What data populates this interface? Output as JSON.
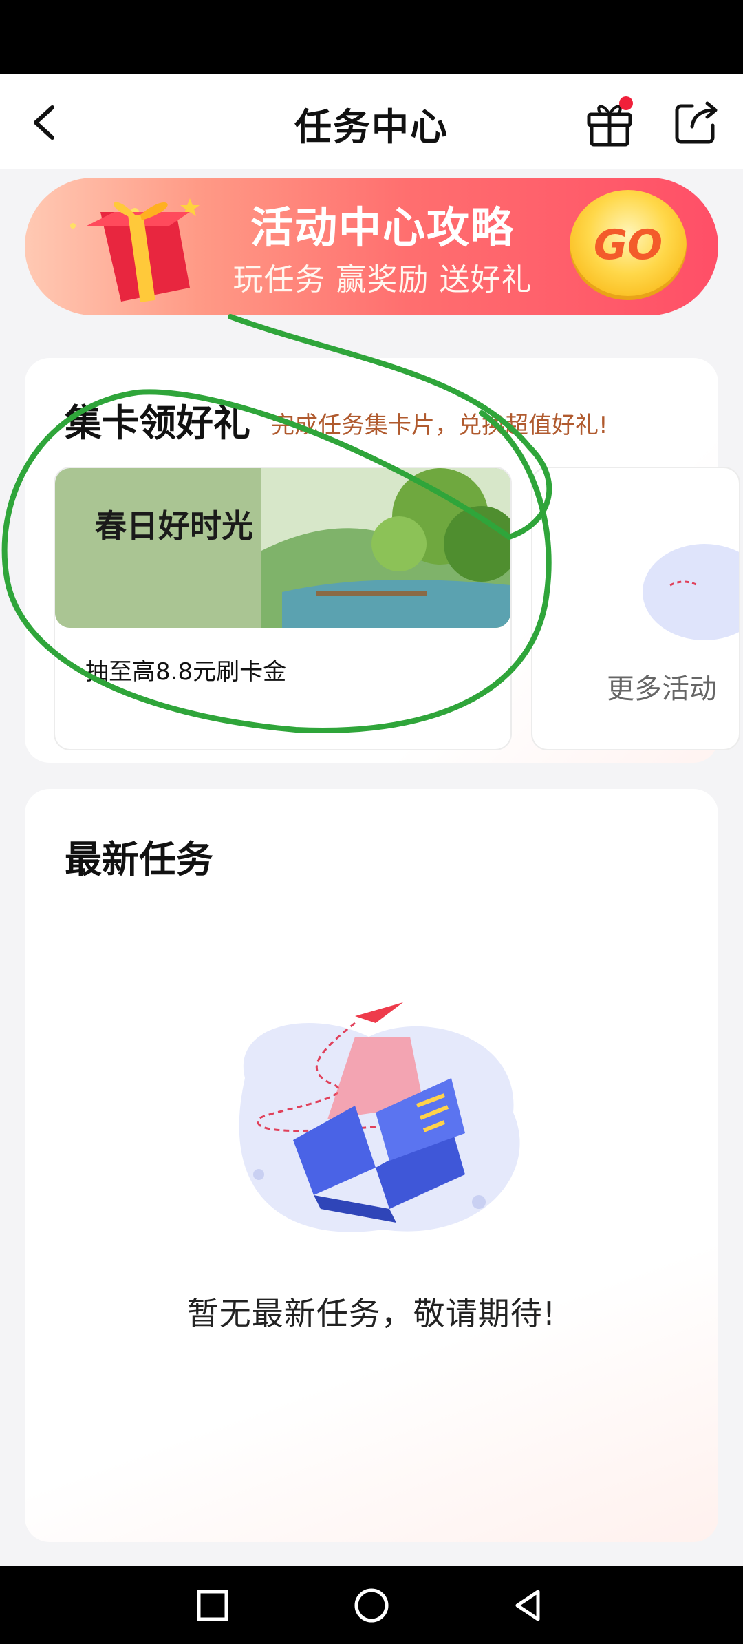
{
  "header": {
    "title": "任务中心",
    "has_notification_dot": true
  },
  "banner": {
    "title": "活动中心攻略",
    "subtitle": "玩任务 赢奖励 送好礼",
    "go_label": "GO"
  },
  "card_collect": {
    "title": "集卡领好礼",
    "subtitle": "完成任务集卡片，兑换超值好礼!",
    "activities": [
      {
        "title": "春日好时光",
        "desc": "抽至高8.8元刷卡金"
      }
    ],
    "more_label": "更多活动"
  },
  "latest_tasks": {
    "title": "最新任务",
    "empty_text": "暂无最新任务，敬请期待!"
  },
  "colors": {
    "accent_red": "#ff4f67",
    "annotation_green": "#2fa53a",
    "subtitle_brown": "#b05a2e"
  }
}
